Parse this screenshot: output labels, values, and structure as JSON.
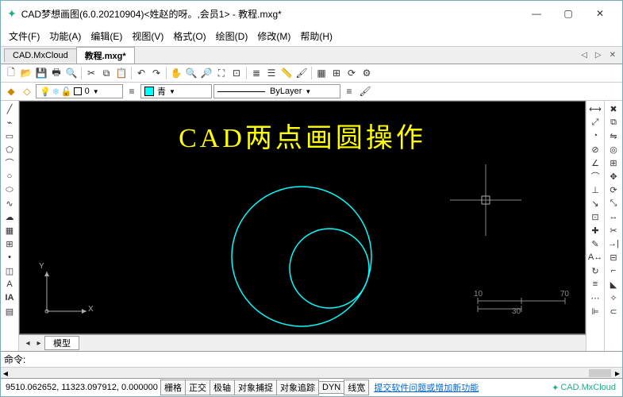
{
  "window": {
    "title": "CAD梦想画图(6.0.20210904)<姓赵的呀。,会员1> - 教程.mxg*"
  },
  "menu": {
    "file": "文件(F)",
    "function": "功能(A)",
    "edit": "编辑(E)",
    "view": "视图(V)",
    "format": "格式(O)",
    "draw": "绘图(D)",
    "modify": "修改(M)",
    "help": "帮助(H)"
  },
  "tabs": {
    "t1": "CAD.MxCloud",
    "t2": "教程.mxg*"
  },
  "props": {
    "layer_selected": "0",
    "color_name": "青",
    "linetype": "ByLayer"
  },
  "canvas": {
    "main_text": "CAD两点画圆操作",
    "ucs_x": "X",
    "ucs_y": "Y",
    "ruler_10": "10",
    "ruler_30": "30",
    "ruler_70": "70"
  },
  "model_tab": "模型",
  "command": {
    "prompt": "命令:",
    "value": ""
  },
  "status": {
    "coords": "9510.062652, 11323.097912, 0.000000",
    "grid": "栅格",
    "ortho": "正交",
    "polar": "极轴",
    "osnap": "对象捕捉",
    "otrack": "对象追踪",
    "dyn": "DYN",
    "lwt": "线宽",
    "feedback_link": "提交软件问题或增加新功能",
    "brand": "CAD.MxCloud"
  }
}
